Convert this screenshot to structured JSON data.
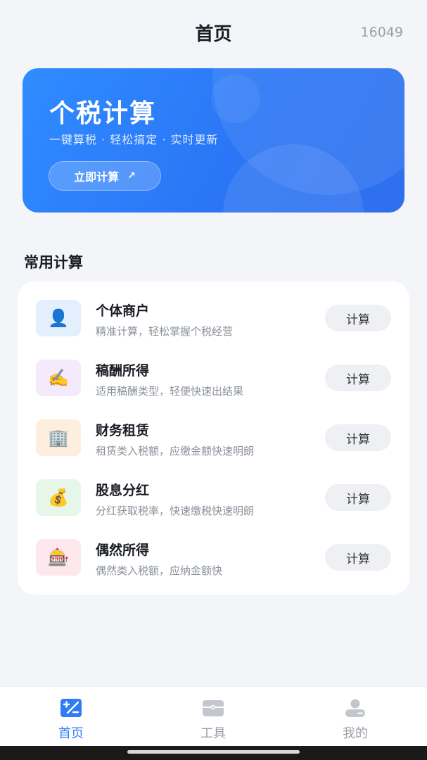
{
  "header": {
    "title": "首页",
    "id_text": "16049"
  },
  "banner": {
    "title": "个税计算",
    "subtitle": "一键算税 · 轻松搞定 · 实时更新",
    "button_label": "立即计算",
    "button_icon": "arrow-up-right-icon",
    "colors": {
      "start": "#2f8cff",
      "end": "#2f6fee"
    }
  },
  "section": {
    "title": "常用计算"
  },
  "items": [
    {
      "name": "个体商户",
      "desc": "精准计算，轻松掌握个税经营",
      "button": "计算",
      "icon": "person-icon",
      "icon_glyph": "👤",
      "icon_bg": "#e3effd"
    },
    {
      "name": "稿酬所得",
      "desc": "适用稿酬类型，轻便快速出结果",
      "button": "计算",
      "icon": "writing-hand-icon",
      "icon_glyph": "✍️",
      "icon_bg": "#f4eafc"
    },
    {
      "name": "财务租赁",
      "desc": "租赁类入税额，应缴金额快速明朗",
      "button": "计算",
      "icon": "office-building-icon",
      "icon_glyph": "🏢",
      "icon_bg": "#fdeedd"
    },
    {
      "name": "股息分红",
      "desc": "分红获取税率，快速缴税快速明朗",
      "button": "计算",
      "icon": "money-bag-icon",
      "icon_glyph": "💰",
      "icon_bg": "#e6f7e9"
    },
    {
      "name": "偶然所得",
      "desc": "偶然类入税额，应纳金额快",
      "button": "计算",
      "icon": "slot-machine-icon",
      "icon_glyph": "🎰",
      "icon_bg": "#fde8ed"
    }
  ],
  "tabbar": {
    "active_color": "#2f7cf6",
    "tabs": [
      {
        "label": "首页",
        "icon": "calculator-icon",
        "active": true
      },
      {
        "label": "工具",
        "icon": "toolbox-icon",
        "active": false
      },
      {
        "label": "我的",
        "icon": "user-icon",
        "active": false
      }
    ]
  }
}
